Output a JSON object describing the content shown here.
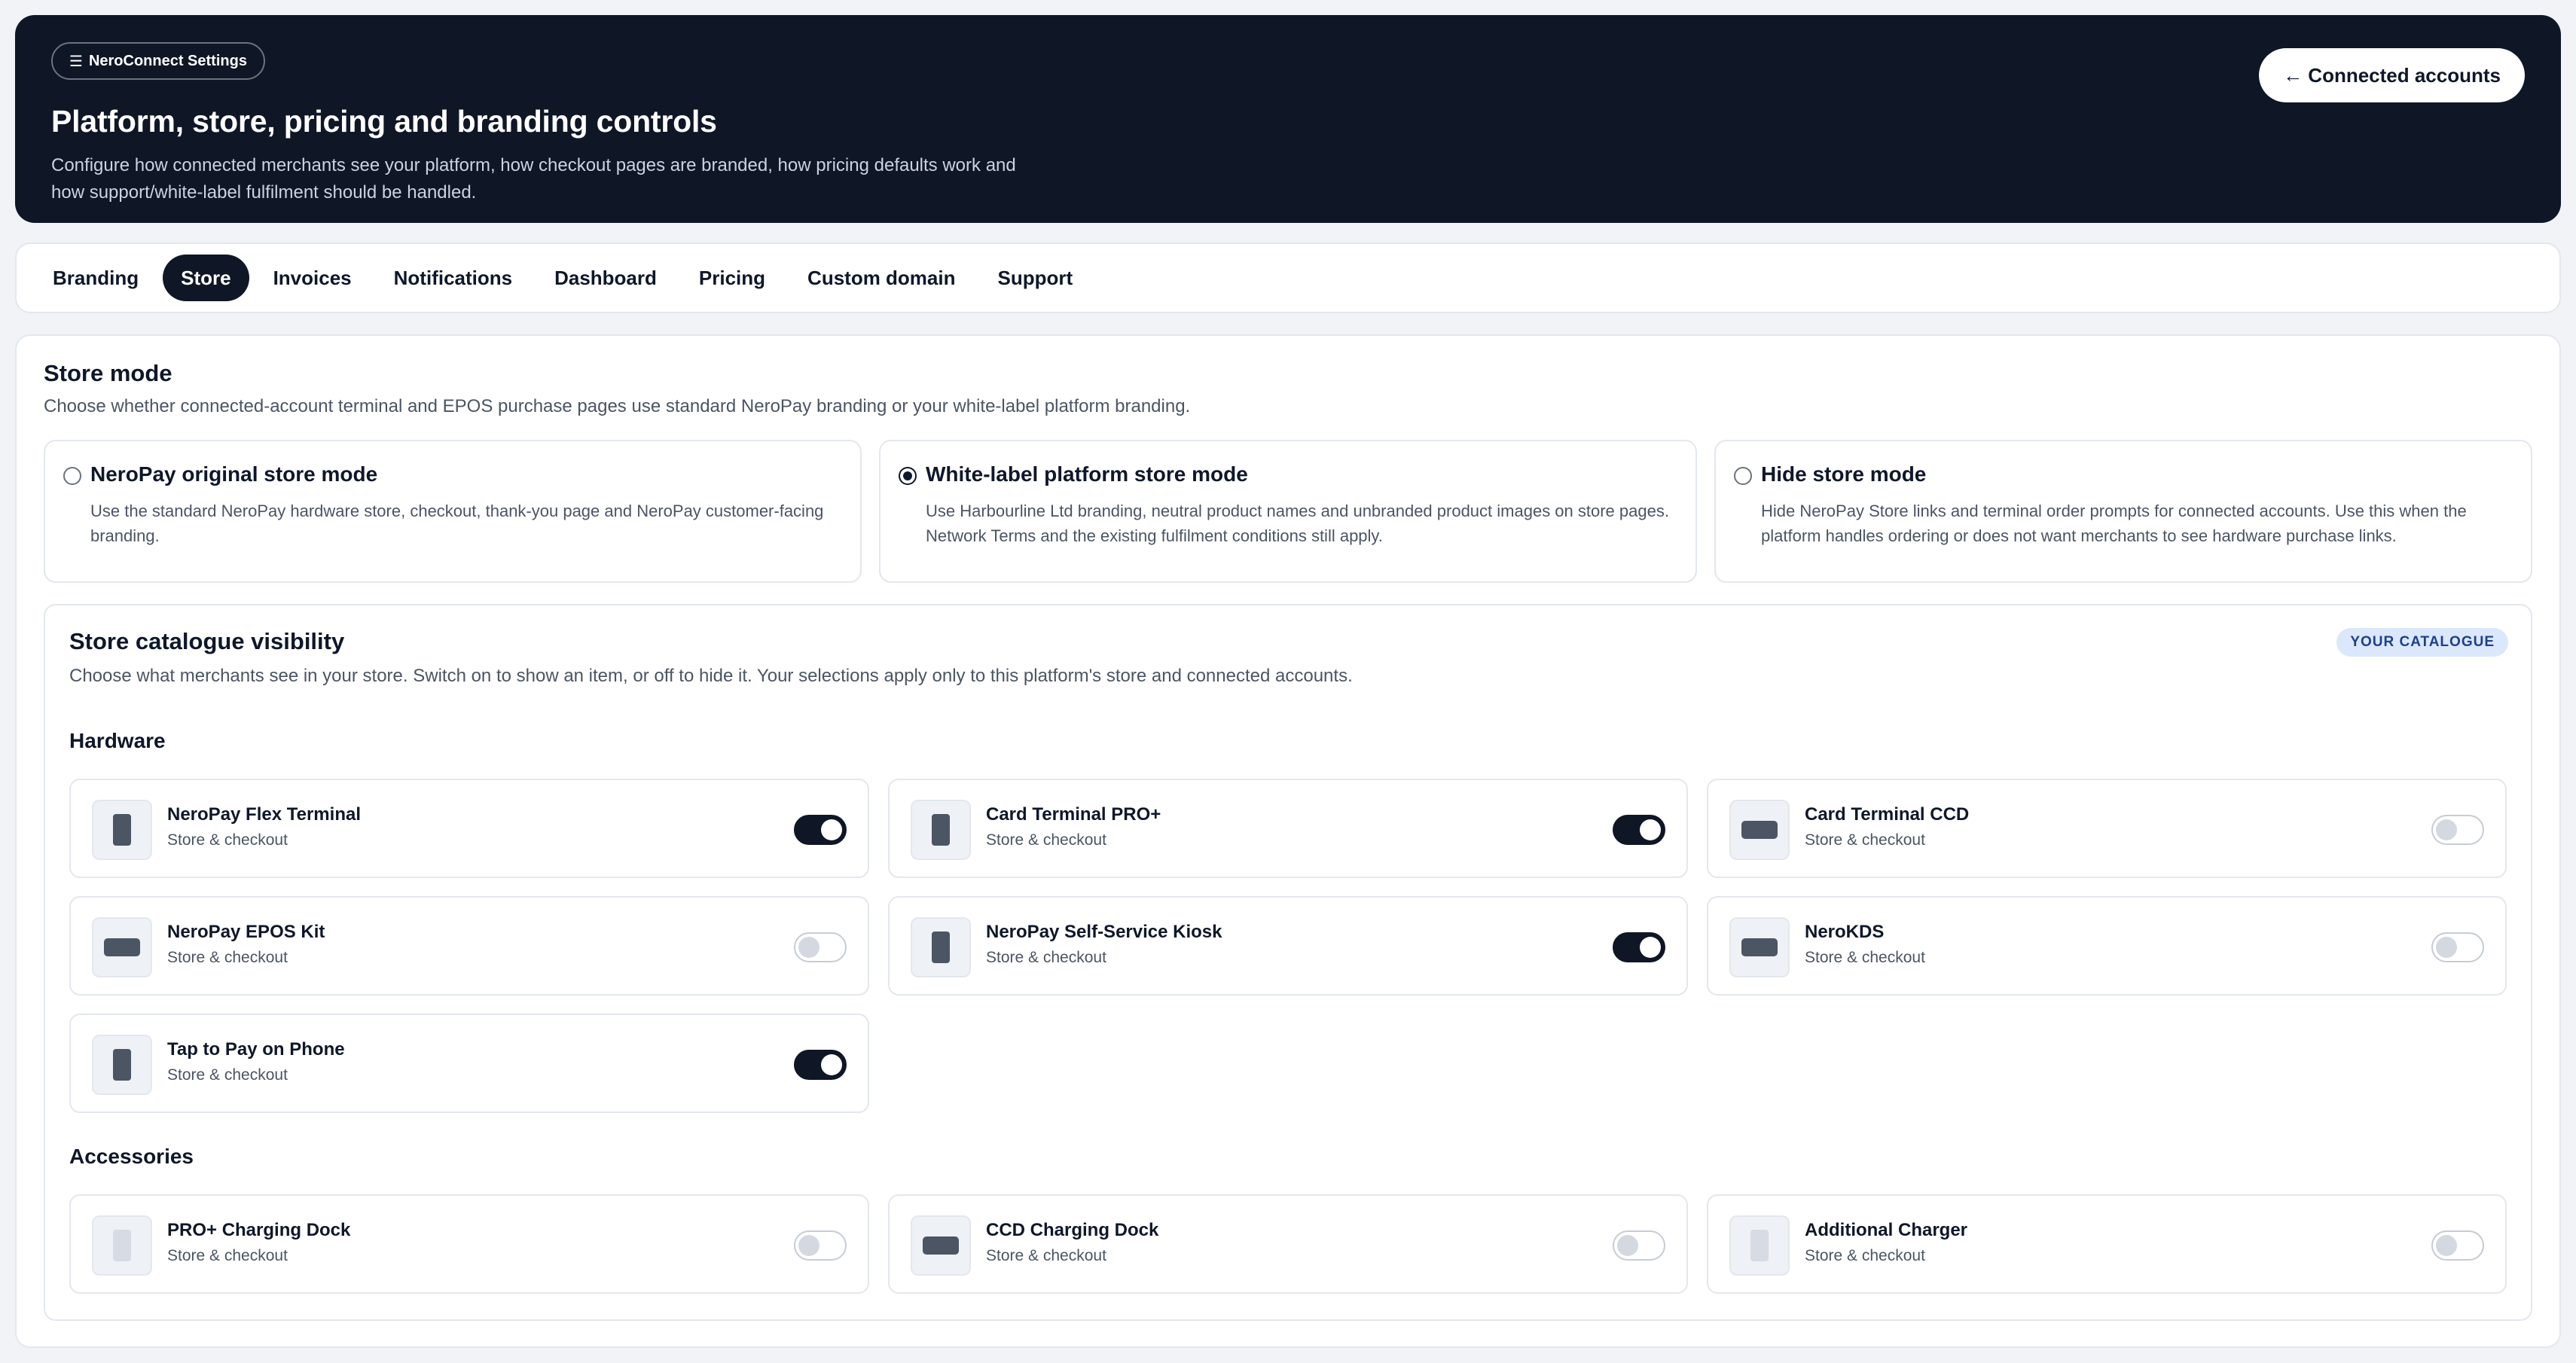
{
  "header": {
    "breadcrumb": "NeroConnect Settings",
    "breadcrumb_icon": "menu-icon",
    "title": "Platform, store, pricing and branding controls",
    "subtitle": "Configure how connected merchants see your platform, how checkout pages are branded, how pricing defaults work and how support/white-label fulfilment should be handled.",
    "back_button": "← Connected accounts"
  },
  "tabs": [
    {
      "label": "Branding",
      "active": false
    },
    {
      "label": "Store",
      "active": true
    },
    {
      "label": "Invoices",
      "active": false
    },
    {
      "label": "Notifications",
      "active": false
    },
    {
      "label": "Dashboard",
      "active": false
    },
    {
      "label": "Pricing",
      "active": false
    },
    {
      "label": "Custom domain",
      "active": false
    },
    {
      "label": "Support",
      "active": false
    }
  ],
  "store_mode": {
    "title": "Store mode",
    "description": "Choose whether connected-account terminal and EPOS purchase pages use standard NeroPay branding or your white-label platform branding.",
    "options": [
      {
        "title": "NeroPay original store mode",
        "description": "Use the standard NeroPay hardware store, checkout, thank-you page and NeroPay customer-facing branding.",
        "selected": false
      },
      {
        "title": "White-label platform store mode",
        "description": "Use Harbourline Ltd branding, neutral product names and unbranded product images on store pages. Network Terms and the existing fulfilment conditions still apply.",
        "selected": true
      },
      {
        "title": "Hide store mode",
        "description": "Hide NeroPay Store links and terminal order prompts for connected accounts. Use this when the platform handles ordering or does not want merchants to see hardware purchase links.",
        "selected": false
      }
    ]
  },
  "catalogue": {
    "title": "Store catalogue visibility",
    "badge": "YOUR CATALOGUE",
    "description": "Choose what merchants see in your store. Switch on to show an item, or off to hide it. Your selections apply only to this platform's store and connected accounts.",
    "hardware_title": "Hardware",
    "accessories_title": "Accessories",
    "hardware": [
      {
        "name": "NeroPay Flex Terminal",
        "sub": "Store & checkout",
        "enabled": true,
        "icon": "tall"
      },
      {
        "name": "Card Terminal PRO+",
        "sub": "Store & checkout",
        "enabled": true,
        "icon": "tall"
      },
      {
        "name": "Card Terminal CCD",
        "sub": "Store & checkout",
        "enabled": false,
        "icon": "wide"
      },
      {
        "name": "NeroPay EPOS Kit",
        "sub": "Store & checkout",
        "enabled": false,
        "icon": "wide"
      },
      {
        "name": "NeroPay Self-Service Kiosk",
        "sub": "Store & checkout",
        "enabled": true,
        "icon": "tall"
      },
      {
        "name": "NeroKDS",
        "sub": "Store & checkout",
        "enabled": false,
        "icon": "wide"
      },
      {
        "name": "Tap to Pay on Phone",
        "sub": "Store & checkout",
        "enabled": true,
        "icon": "tall"
      }
    ],
    "accessories": [
      {
        "name": "PRO+ Charging Dock",
        "sub": "Store & checkout",
        "enabled": false,
        "icon": "tall-faded"
      },
      {
        "name": "CCD Charging Dock",
        "sub": "Store & checkout",
        "enabled": false,
        "icon": "wide"
      },
      {
        "name": "Additional Charger",
        "sub": "Store & checkout",
        "enabled": false,
        "icon": "tall-faded"
      }
    ]
  },
  "colors": {
    "header_bg": "#0f1626",
    "accent": "#0f1626",
    "badge_bg": "#dbe7fb",
    "badge_text": "#1d3f8f"
  }
}
